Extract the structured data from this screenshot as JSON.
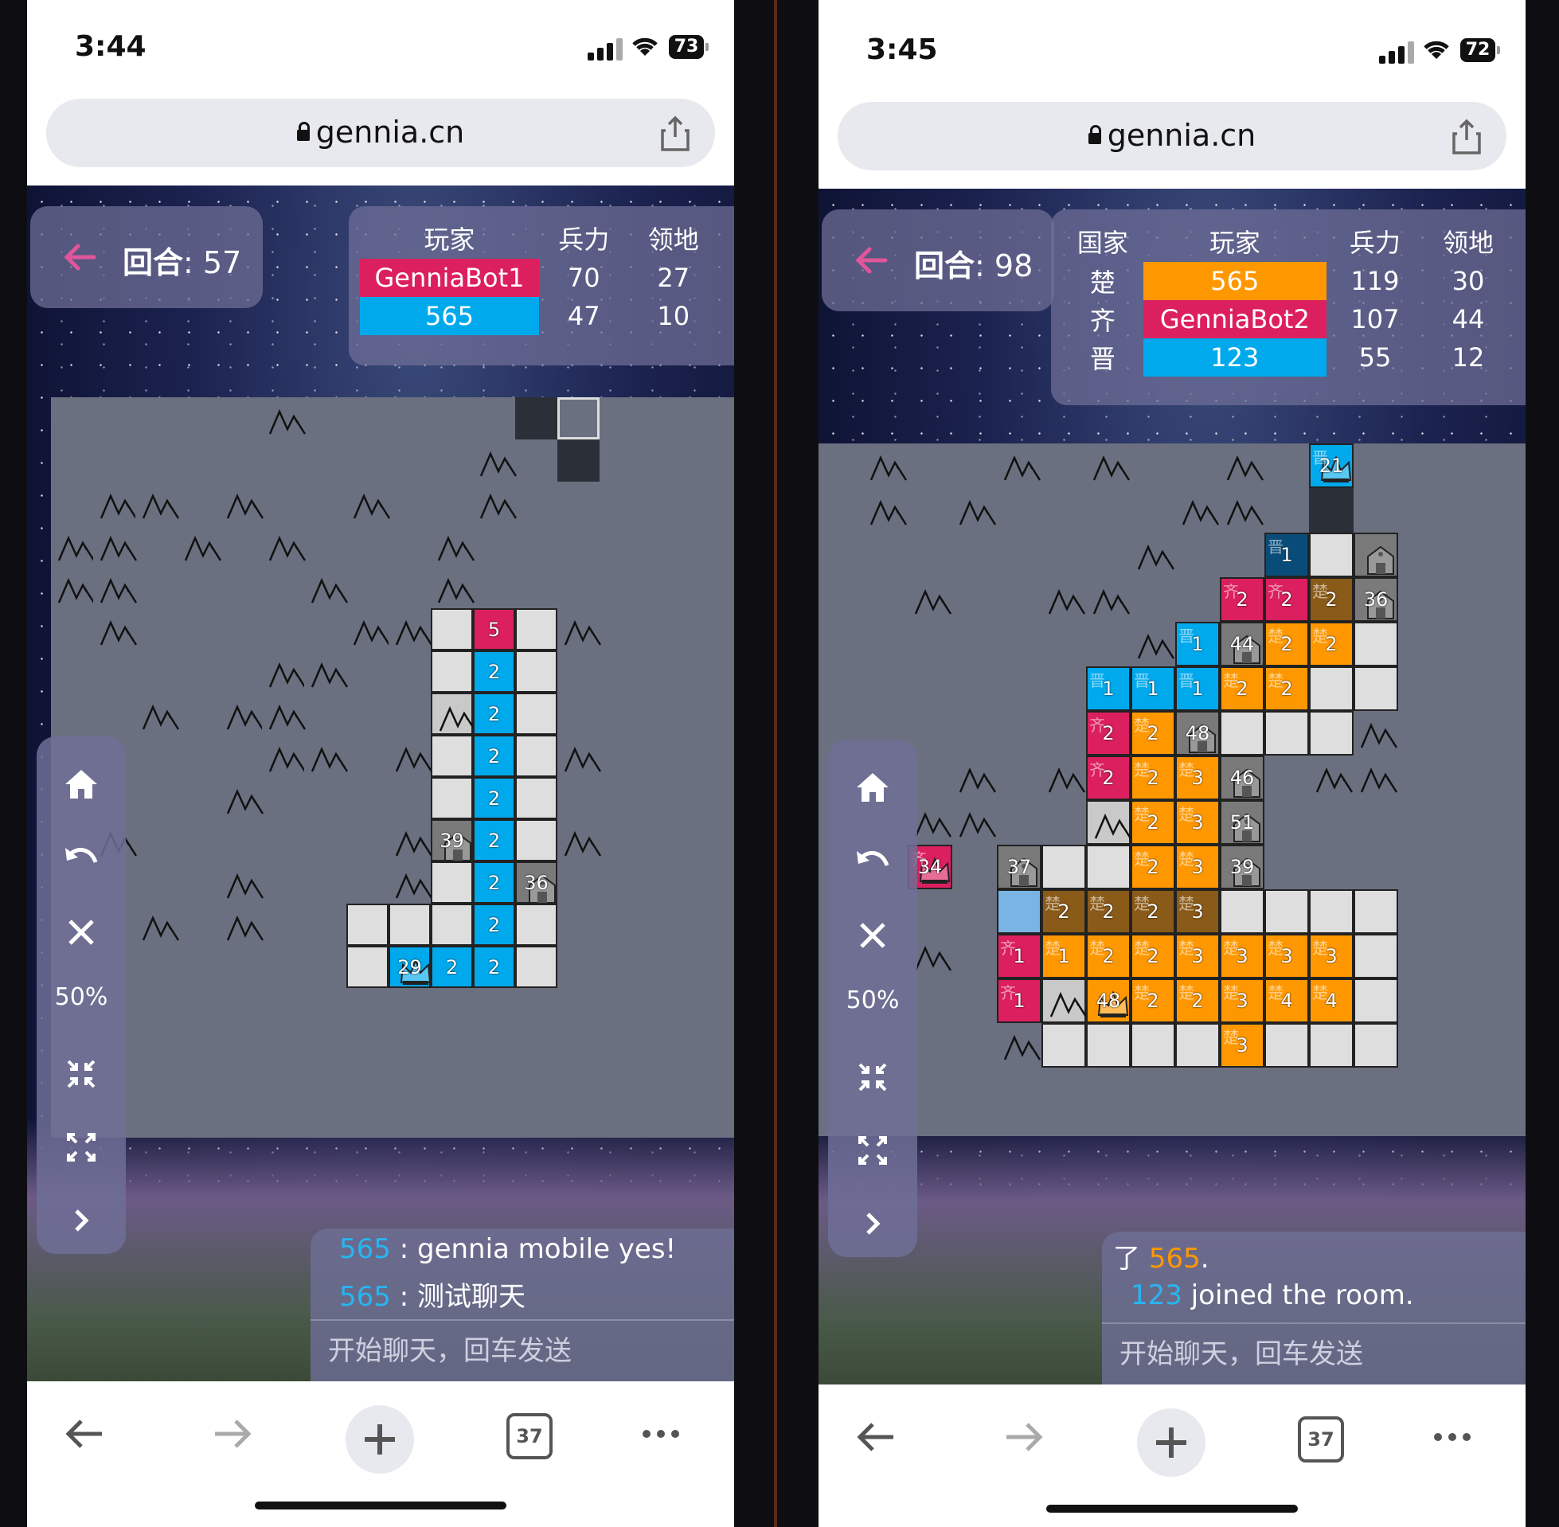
{
  "left": {
    "time": "3:44",
    "battery": "73",
    "url": "gennia.cn",
    "turn_label": "回合",
    "turn_value": ": 57",
    "scoreboard": {
      "headers": [
        "玩家",
        "兵力",
        "领地"
      ],
      "rows": [
        {
          "name": "GenniaBot1",
          "army": "70",
          "land": "27",
          "color": "#dc1f5f"
        },
        {
          "name": "565",
          "army": "47",
          "land": "10",
          "color": "#00a9ec"
        }
      ]
    },
    "zoom": "50%",
    "chat": [
      {
        "user": "565",
        "sep": ":",
        "text": "gennia mobile yes!"
      },
      {
        "user": "565",
        "sep": ":",
        "text": "测试聊天"
      }
    ],
    "chat_placeholder": "开始聊天，回车发送",
    "tabs_count": "37"
  },
  "right": {
    "time": "3:45",
    "battery": "72",
    "url": "gennia.cn",
    "turn_label": "回合",
    "turn_value": ": 98",
    "scoreboard": {
      "headers": [
        "国家",
        "玩家",
        "兵力",
        "领地"
      ],
      "rows": [
        {
          "country": "楚",
          "name": "565",
          "army": "119",
          "land": "30",
          "color": "#ff9800"
        },
        {
          "country": "齐",
          "name": "GenniaBot2",
          "army": "107",
          "land": "44",
          "color": "#dc1f5f"
        },
        {
          "country": "晋",
          "name": "123",
          "army": "55",
          "land": "12",
          "color": "#00a9ec"
        }
      ]
    },
    "zoom": "50%",
    "chat": [
      {
        "user": "565",
        "prefix": "了",
        "text": "."
      },
      {
        "user": "123",
        "text": "joined the room."
      }
    ],
    "chat_placeholder": "开始聊天，回车发送",
    "tabs_count": "37"
  },
  "colors": {
    "red": "#dc1f5f",
    "blue": "#00a9ec",
    "orange": "#ff9800",
    "fog": "#6b7080"
  },
  "icons": [
    "lock-icon",
    "share-icon",
    "back-arrow-icon",
    "home-icon",
    "undo-icon",
    "close-icon",
    "collapse-icon",
    "expand-icon",
    "chevron-right-icon",
    "mountain-icon",
    "city-icon",
    "crown-icon",
    "nav-back-icon",
    "nav-forward-icon",
    "new-tab-icon",
    "tabs-icon",
    "more-icon"
  ],
  "board_left": {
    "cells": [
      {
        "r": 0,
        "c": 11,
        "t": "dark",
        "n": ""
      },
      {
        "r": 0,
        "c": 12,
        "t": "outline",
        "n": ""
      },
      {
        "r": 1,
        "c": 12,
        "t": "dark",
        "n": ""
      },
      {
        "r": 5,
        "c": 9,
        "t": "white",
        "n": ""
      },
      {
        "r": 5,
        "c": 10,
        "t": "red",
        "n": "5"
      },
      {
        "r": 5,
        "c": 11,
        "t": "white",
        "n": ""
      },
      {
        "r": 6,
        "c": 9,
        "t": "white",
        "n": ""
      },
      {
        "r": 6,
        "c": 10,
        "t": "blue",
        "n": "2"
      },
      {
        "r": 6,
        "c": 11,
        "t": "white",
        "n": ""
      },
      {
        "r": 7,
        "c": 9,
        "t": "mtn-white",
        "n": ""
      },
      {
        "r": 7,
        "c": 10,
        "t": "blue",
        "n": "2"
      },
      {
        "r": 7,
        "c": 11,
        "t": "white",
        "n": ""
      },
      {
        "r": 8,
        "c": 9,
        "t": "white",
        "n": ""
      },
      {
        "r": 8,
        "c": 10,
        "t": "blue",
        "n": "2"
      },
      {
        "r": 8,
        "c": 11,
        "t": "white",
        "n": ""
      },
      {
        "r": 9,
        "c": 9,
        "t": "white",
        "n": ""
      },
      {
        "r": 9,
        "c": 10,
        "t": "blue",
        "n": "2"
      },
      {
        "r": 9,
        "c": 11,
        "t": "white",
        "n": ""
      },
      {
        "r": 10,
        "c": 9,
        "t": "city",
        "n": "39"
      },
      {
        "r": 10,
        "c": 10,
        "t": "blue",
        "n": "2"
      },
      {
        "r": 10,
        "c": 11,
        "t": "white",
        "n": ""
      },
      {
        "r": 11,
        "c": 9,
        "t": "white",
        "n": ""
      },
      {
        "r": 11,
        "c": 10,
        "t": "blue",
        "n": "2"
      },
      {
        "r": 11,
        "c": 11,
        "t": "city",
        "n": "36"
      },
      {
        "r": 12,
        "c": 7,
        "t": "white",
        "n": ""
      },
      {
        "r": 12,
        "c": 8,
        "t": "white",
        "n": ""
      },
      {
        "r": 12,
        "c": 9,
        "t": "white",
        "n": ""
      },
      {
        "r": 12,
        "c": 10,
        "t": "blue",
        "n": "2"
      },
      {
        "r": 12,
        "c": 11,
        "t": "white",
        "n": ""
      },
      {
        "r": 13,
        "c": 7,
        "t": "white",
        "n": ""
      },
      {
        "r": 13,
        "c": 8,
        "t": "blue-crown",
        "n": "29"
      },
      {
        "r": 13,
        "c": 9,
        "t": "blue",
        "n": "2"
      },
      {
        "r": 13,
        "c": 10,
        "t": "blue",
        "n": "2"
      },
      {
        "r": 13,
        "c": 11,
        "t": "white",
        "n": ""
      }
    ],
    "mountains": [
      [
        0,
        5
      ],
      [
        1,
        10
      ],
      [
        2,
        1
      ],
      [
        2,
        2
      ],
      [
        2,
        4
      ],
      [
        2,
        7
      ],
      [
        2,
        10
      ],
      [
        3,
        0
      ],
      [
        3,
        1
      ],
      [
        3,
        3
      ],
      [
        3,
        5
      ],
      [
        3,
        9
      ],
      [
        4,
        0
      ],
      [
        4,
        1
      ],
      [
        4,
        6
      ],
      [
        4,
        9
      ],
      [
        5,
        1
      ],
      [
        5,
        7
      ],
      [
        5,
        8
      ],
      [
        5,
        12
      ],
      [
        6,
        5
      ],
      [
        6,
        6
      ],
      [
        7,
        2
      ],
      [
        7,
        4
      ],
      [
        7,
        5
      ],
      [
        8,
        5
      ],
      [
        8,
        6
      ],
      [
        8,
        8
      ],
      [
        8,
        12
      ],
      [
        9,
        4
      ],
      [
        10,
        1
      ],
      [
        10,
        8
      ],
      [
        10,
        12
      ],
      [
        11,
        4
      ],
      [
        11,
        8
      ],
      [
        12,
        2
      ],
      [
        12,
        4
      ]
    ]
  },
  "board_right": {
    "cells": [
      {
        "r": 0,
        "c": 11,
        "t": "blue-crown",
        "n": "21",
        "g": "晋"
      },
      {
        "r": 1,
        "c": 11,
        "t": "dark",
        "n": "",
        "g": ""
      },
      {
        "r": 2,
        "c": 10,
        "t": "navy",
        "n": "1",
        "g": "晋"
      },
      {
        "r": 2,
        "c": 11,
        "t": "white",
        "n": "",
        "g": ""
      },
      {
        "r": 2,
        "c": 12,
        "t": "city",
        "n": "",
        "g": ""
      },
      {
        "r": 3,
        "c": 9,
        "t": "red",
        "n": "2",
        "g": "齐"
      },
      {
        "r": 3,
        "c": 10,
        "t": "red",
        "n": "2",
        "g": "齐"
      },
      {
        "r": 3,
        "c": 11,
        "t": "brown",
        "n": "2",
        "g": "楚"
      },
      {
        "r": 3,
        "c": 12,
        "t": "city",
        "n": "36",
        "g": ""
      },
      {
        "r": 4,
        "c": 8,
        "t": "blue",
        "n": "1",
        "g": "晋"
      },
      {
        "r": 4,
        "c": 9,
        "t": "city",
        "n": "44",
        "g": ""
      },
      {
        "r": 4,
        "c": 10,
        "t": "orange",
        "n": "2",
        "g": "楚"
      },
      {
        "r": 4,
        "c": 11,
        "t": "orange",
        "n": "2",
        "g": "楚"
      },
      {
        "r": 4,
        "c": 12,
        "t": "white",
        "n": "",
        "g": ""
      },
      {
        "r": 5,
        "c": 6,
        "t": "blue",
        "n": "1",
        "g": "晋"
      },
      {
        "r": 5,
        "c": 7,
        "t": "blue",
        "n": "1",
        "g": "晋"
      },
      {
        "r": 5,
        "c": 8,
        "t": "blue",
        "n": "1",
        "g": "晋"
      },
      {
        "r": 5,
        "c": 9,
        "t": "orange",
        "n": "2",
        "g": "楚"
      },
      {
        "r": 5,
        "c": 10,
        "t": "orange",
        "n": "2",
        "g": "楚"
      },
      {
        "r": 5,
        "c": 11,
        "t": "white",
        "n": "",
        "g": ""
      },
      {
        "r": 5,
        "c": 12,
        "t": "white",
        "n": "",
        "g": ""
      },
      {
        "r": 6,
        "c": 6,
        "t": "red",
        "n": "2",
        "g": "齐"
      },
      {
        "r": 6,
        "c": 7,
        "t": "orange",
        "n": "2",
        "g": "楚"
      },
      {
        "r": 6,
        "c": 8,
        "t": "city",
        "n": "48",
        "g": ""
      },
      {
        "r": 6,
        "c": 9,
        "t": "white",
        "n": "",
        "g": ""
      },
      {
        "r": 6,
        "c": 10,
        "t": "white",
        "n": "",
        "g": ""
      },
      {
        "r": 6,
        "c": 11,
        "t": "white",
        "n": "",
        "g": ""
      },
      {
        "r": 7,
        "c": 6,
        "t": "red",
        "n": "2",
        "g": "齐"
      },
      {
        "r": 7,
        "c": 7,
        "t": "orange",
        "n": "2",
        "g": "楚"
      },
      {
        "r": 7,
        "c": 8,
        "t": "orange",
        "n": "3",
        "g": "楚"
      },
      {
        "r": 7,
        "c": 9,
        "t": "city",
        "n": "46",
        "g": ""
      },
      {
        "r": 8,
        "c": 6,
        "t": "mtn-white",
        "n": "",
        "g": ""
      },
      {
        "r": 8,
        "c": 7,
        "t": "orange",
        "n": "2",
        "g": "楚"
      },
      {
        "r": 8,
        "c": 8,
        "t": "orange",
        "n": "3",
        "g": "楚"
      },
      {
        "r": 8,
        "c": 9,
        "t": "city",
        "n": "51",
        "g": ""
      },
      {
        "r": 9,
        "c": 2,
        "t": "red-crown",
        "n": "34",
        "g": "齐"
      },
      {
        "r": 9,
        "c": 4,
        "t": "city",
        "n": "37",
        "g": ""
      },
      {
        "r": 9,
        "c": 5,
        "t": "white",
        "n": "",
        "g": ""
      },
      {
        "r": 9,
        "c": 6,
        "t": "white",
        "n": "",
        "g": ""
      },
      {
        "r": 9,
        "c": 7,
        "t": "orange",
        "n": "2",
        "g": "楚"
      },
      {
        "r": 9,
        "c": 8,
        "t": "orange",
        "n": "3",
        "g": "楚"
      },
      {
        "r": 9,
        "c": 9,
        "t": "city",
        "n": "39",
        "g": ""
      },
      {
        "r": 10,
        "c": 4,
        "t": "lightblue",
        "n": "",
        "g": ""
      },
      {
        "r": 10,
        "c": 5,
        "t": "brown",
        "n": "2",
        "g": "楚"
      },
      {
        "r": 10,
        "c": 6,
        "t": "brown",
        "n": "2",
        "g": "楚"
      },
      {
        "r": 10,
        "c": 7,
        "t": "brown",
        "n": "2",
        "g": "楚"
      },
      {
        "r": 10,
        "c": 8,
        "t": "brown",
        "n": "3",
        "g": "楚"
      },
      {
        "r": 10,
        "c": 9,
        "t": "white",
        "n": "",
        "g": ""
      },
      {
        "r": 10,
        "c": 10,
        "t": "white",
        "n": "",
        "g": ""
      },
      {
        "r": 10,
        "c": 11,
        "t": "white",
        "n": "",
        "g": ""
      },
      {
        "r": 10,
        "c": 12,
        "t": "white",
        "n": "",
        "g": ""
      },
      {
        "r": 11,
        "c": 4,
        "t": "red",
        "n": "1",
        "g": "齐"
      },
      {
        "r": 11,
        "c": 5,
        "t": "orange",
        "n": "1",
        "g": "楚"
      },
      {
        "r": 11,
        "c": 6,
        "t": "orange",
        "n": "2",
        "g": "楚"
      },
      {
        "r": 11,
        "c": 7,
        "t": "orange",
        "n": "2",
        "g": "楚"
      },
      {
        "r": 11,
        "c": 8,
        "t": "orange",
        "n": "3",
        "g": "楚"
      },
      {
        "r": 11,
        "c": 9,
        "t": "orange",
        "n": "3",
        "g": "楚"
      },
      {
        "r": 11,
        "c": 10,
        "t": "orange",
        "n": "3",
        "g": "楚"
      },
      {
        "r": 11,
        "c": 11,
        "t": "orange",
        "n": "3",
        "g": "楚"
      },
      {
        "r": 11,
        "c": 12,
        "t": "white",
        "n": "",
        "g": ""
      },
      {
        "r": 12,
        "c": 4,
        "t": "red",
        "n": "1",
        "g": "齐"
      },
      {
        "r": 12,
        "c": 5,
        "t": "mtn-white",
        "n": "",
        "g": ""
      },
      {
        "r": 12,
        "c": 6,
        "t": "orange-crown",
        "n": "48",
        "g": ""
      },
      {
        "r": 12,
        "c": 7,
        "t": "orange",
        "n": "2",
        "g": "楚"
      },
      {
        "r": 12,
        "c": 8,
        "t": "orange",
        "n": "2",
        "g": "楚"
      },
      {
        "r": 12,
        "c": 9,
        "t": "orange",
        "n": "3",
        "g": "楚"
      },
      {
        "r": 12,
        "c": 10,
        "t": "orange",
        "n": "4",
        "g": "楚"
      },
      {
        "r": 12,
        "c": 11,
        "t": "orange",
        "n": "4",
        "g": "楚"
      },
      {
        "r": 12,
        "c": 12,
        "t": "white",
        "n": "",
        "g": ""
      },
      {
        "r": 13,
        "c": 5,
        "t": "white",
        "n": "",
        "g": ""
      },
      {
        "r": 13,
        "c": 6,
        "t": "white",
        "n": "",
        "g": ""
      },
      {
        "r": 13,
        "c": 7,
        "t": "white",
        "n": "",
        "g": ""
      },
      {
        "r": 13,
        "c": 8,
        "t": "white",
        "n": "",
        "g": ""
      },
      {
        "r": 13,
        "c": 9,
        "t": "orange",
        "n": "3",
        "g": "楚"
      },
      {
        "r": 13,
        "c": 10,
        "t": "white",
        "n": "",
        "g": ""
      },
      {
        "r": 13,
        "c": 11,
        "t": "white",
        "n": "",
        "g": ""
      },
      {
        "r": 13,
        "c": 12,
        "t": "white",
        "n": "",
        "g": ""
      }
    ],
    "mountains": [
      [
        0,
        1
      ],
      [
        0,
        4
      ],
      [
        0,
        6
      ],
      [
        0,
        9
      ],
      [
        1,
        1
      ],
      [
        1,
        3
      ],
      [
        1,
        8
      ],
      [
        1,
        9
      ],
      [
        2,
        7
      ],
      [
        3,
        2
      ],
      [
        3,
        5
      ],
      [
        3,
        6
      ],
      [
        4,
        7
      ],
      [
        6,
        12
      ],
      [
        7,
        3
      ],
      [
        7,
        5
      ],
      [
        7,
        11
      ],
      [
        7,
        12
      ],
      [
        8,
        2
      ],
      [
        8,
        3
      ],
      [
        11,
        2
      ],
      [
        13,
        4
      ]
    ]
  }
}
